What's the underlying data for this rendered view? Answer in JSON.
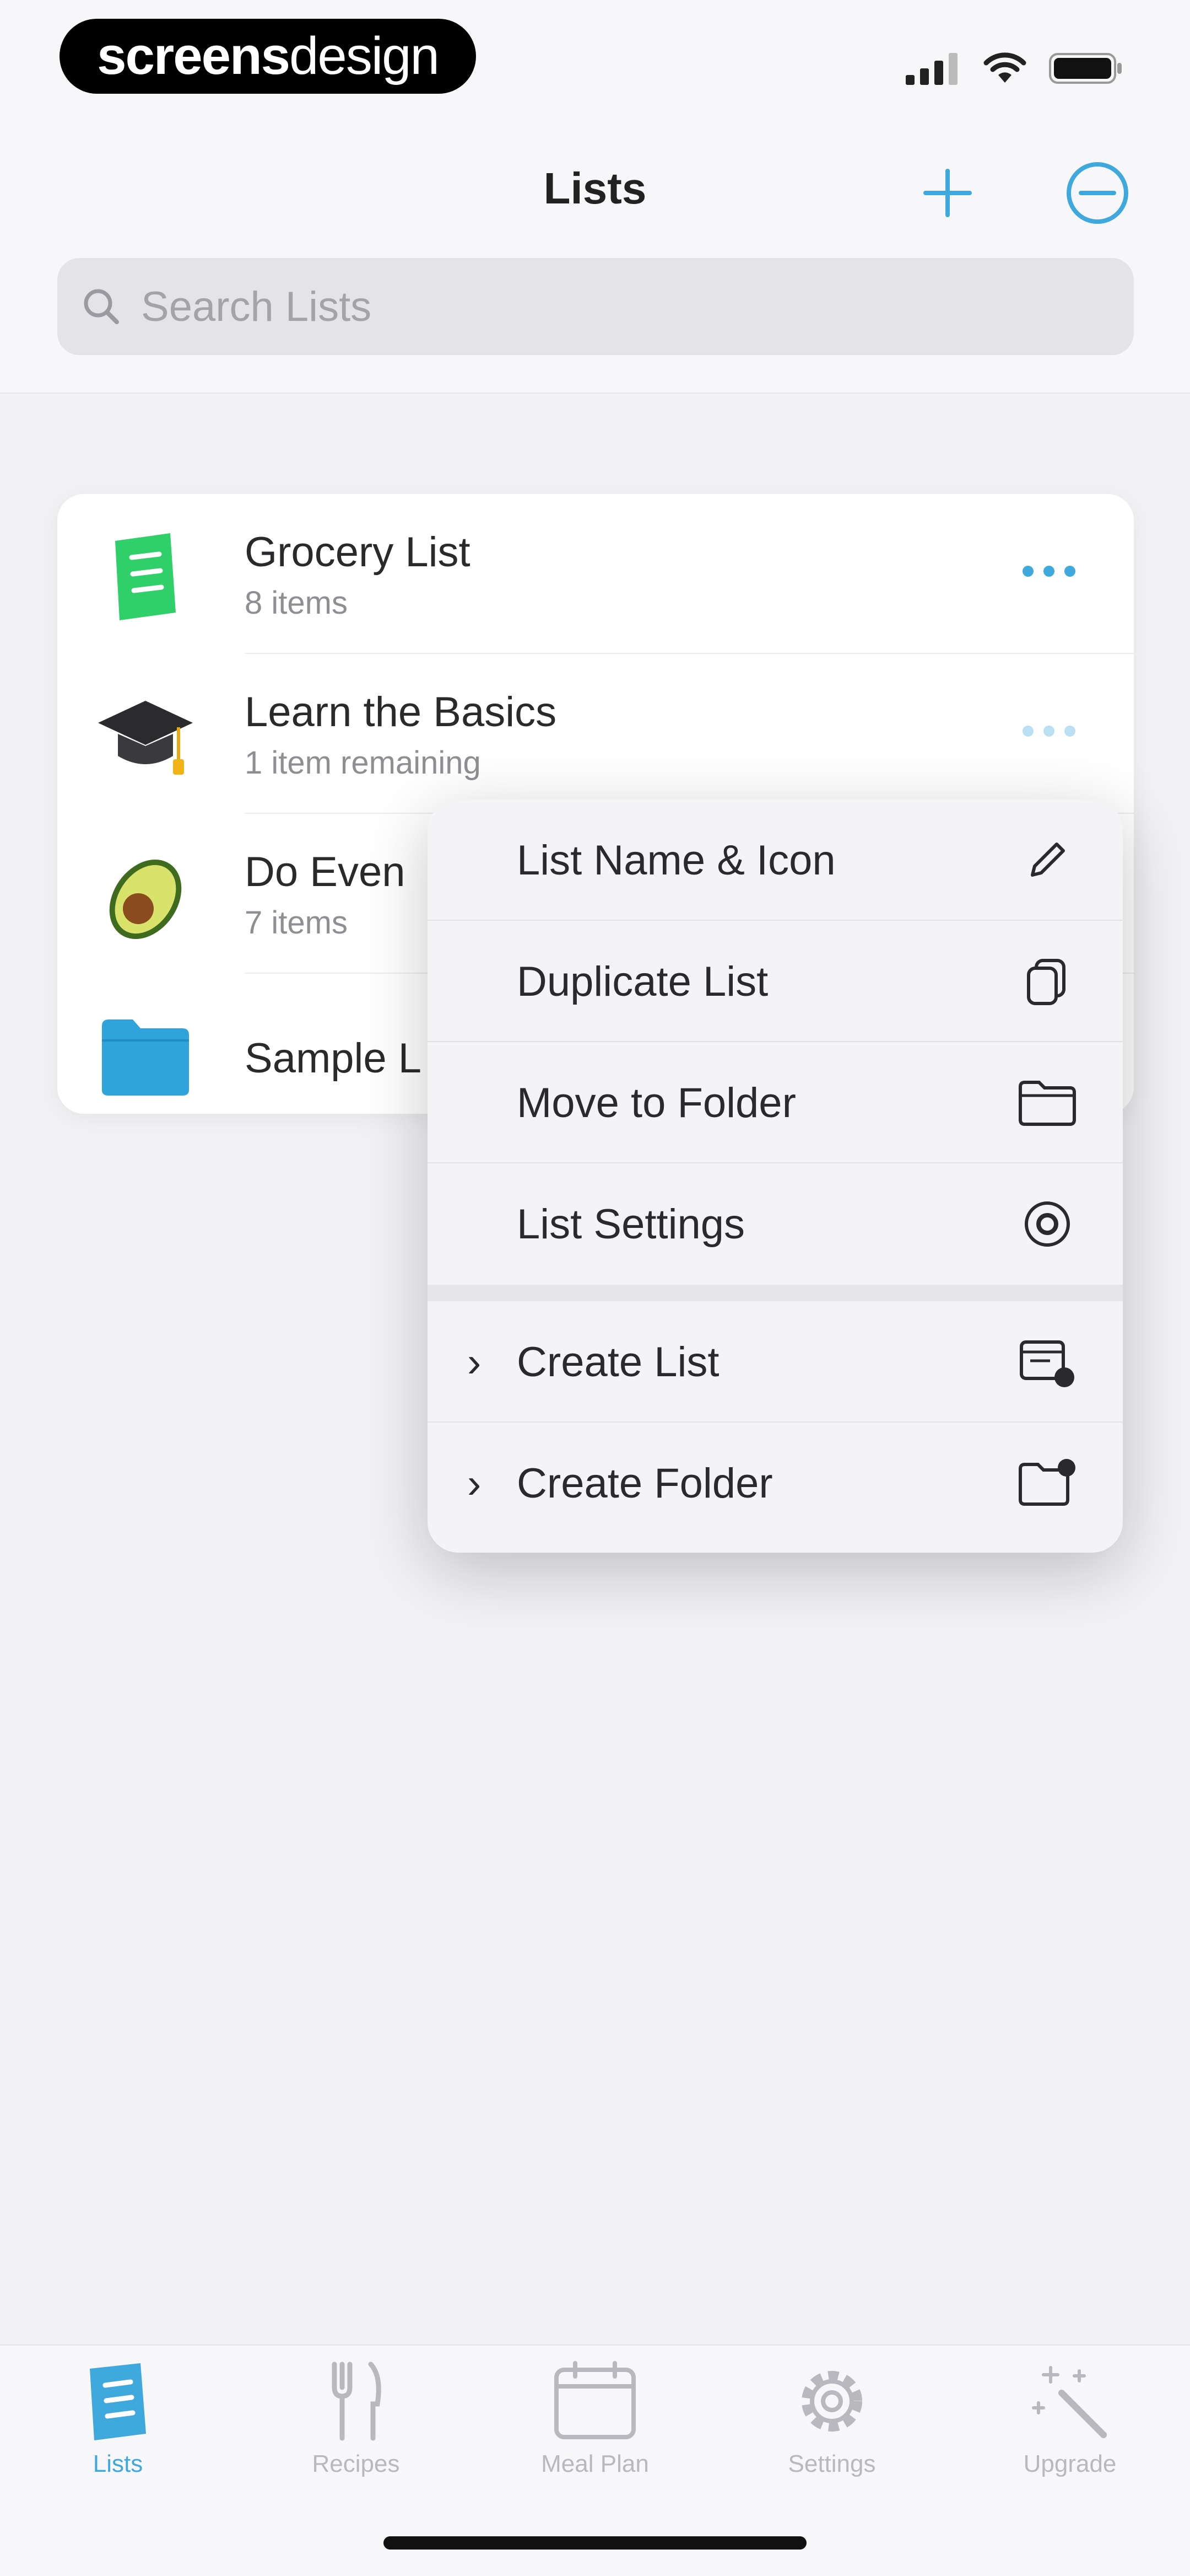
{
  "status_bar": {
    "badge_bold": "screens",
    "badge_light": "design"
  },
  "nav": {
    "title": "Lists",
    "search_placeholder": "Search Lists"
  },
  "lists": [
    {
      "title": "Grocery List",
      "subtitle": "8 items",
      "icon": "grocery-list-icon"
    },
    {
      "title": "Learn the Basics",
      "subtitle": "1 item remaining",
      "icon": "graduation-cap-icon"
    },
    {
      "title": "Do Even",
      "subtitle": "7 items",
      "icon": "avocado-icon"
    },
    {
      "title": "Sample L",
      "subtitle": "",
      "icon": "folder-icon"
    }
  ],
  "context_menu": {
    "items": [
      {
        "label": "List Name & Icon",
        "icon": "pencil-icon"
      },
      {
        "label": "Duplicate List",
        "icon": "duplicate-icon"
      },
      {
        "label": "Move to Folder",
        "icon": "folder-outline-icon"
      },
      {
        "label": "List Settings",
        "icon": "gear-icon"
      },
      {
        "label": "Create List",
        "icon": "create-list-icon"
      },
      {
        "label": "Create Folder",
        "icon": "create-folder-icon"
      }
    ]
  },
  "tabs": [
    {
      "label": "Lists",
      "icon": "lists-icon",
      "active": true
    },
    {
      "label": "Recipes",
      "icon": "fork-knife-icon",
      "active": false
    },
    {
      "label": "Meal Plan",
      "icon": "calendar-icon",
      "active": false
    },
    {
      "label": "Settings",
      "icon": "settings-gear-icon",
      "active": false
    },
    {
      "label": "Upgrade",
      "icon": "magic-wand-icon",
      "active": false
    }
  ],
  "colors": {
    "accent": "#3fa9dd",
    "grocery_green": "#2fcf6a",
    "folder_blue": "#2fa3dc",
    "inactive_tab": "#b8b8be"
  }
}
